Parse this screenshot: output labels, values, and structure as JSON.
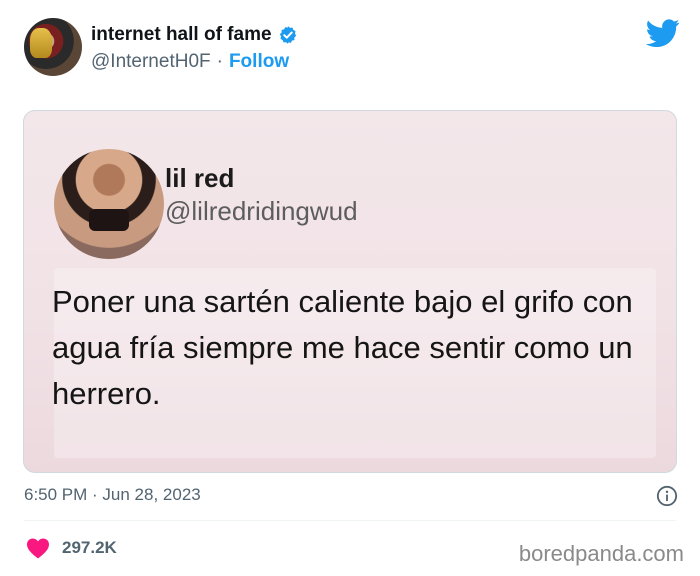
{
  "author": {
    "name": "internet hall of fame",
    "handle": "@InternetH0F",
    "separator": "·",
    "follow_label": "Follow"
  },
  "embedded": {
    "name": "lil red",
    "handle": "@lilredridingwud",
    "text": "Poner una sartén caliente bajo el grifo con agua fría siempre me hace sentir como un herrero."
  },
  "meta": {
    "timestamp": "6:50 PM · Jun 28, 2023",
    "likes": "297.2K"
  },
  "watermark": "boredpanda.com",
  "colors": {
    "accent": "#1d9bf0",
    "heart": "#f91880"
  },
  "icons": [
    "verified-icon",
    "twitter-icon",
    "info-icon",
    "heart-icon"
  ]
}
